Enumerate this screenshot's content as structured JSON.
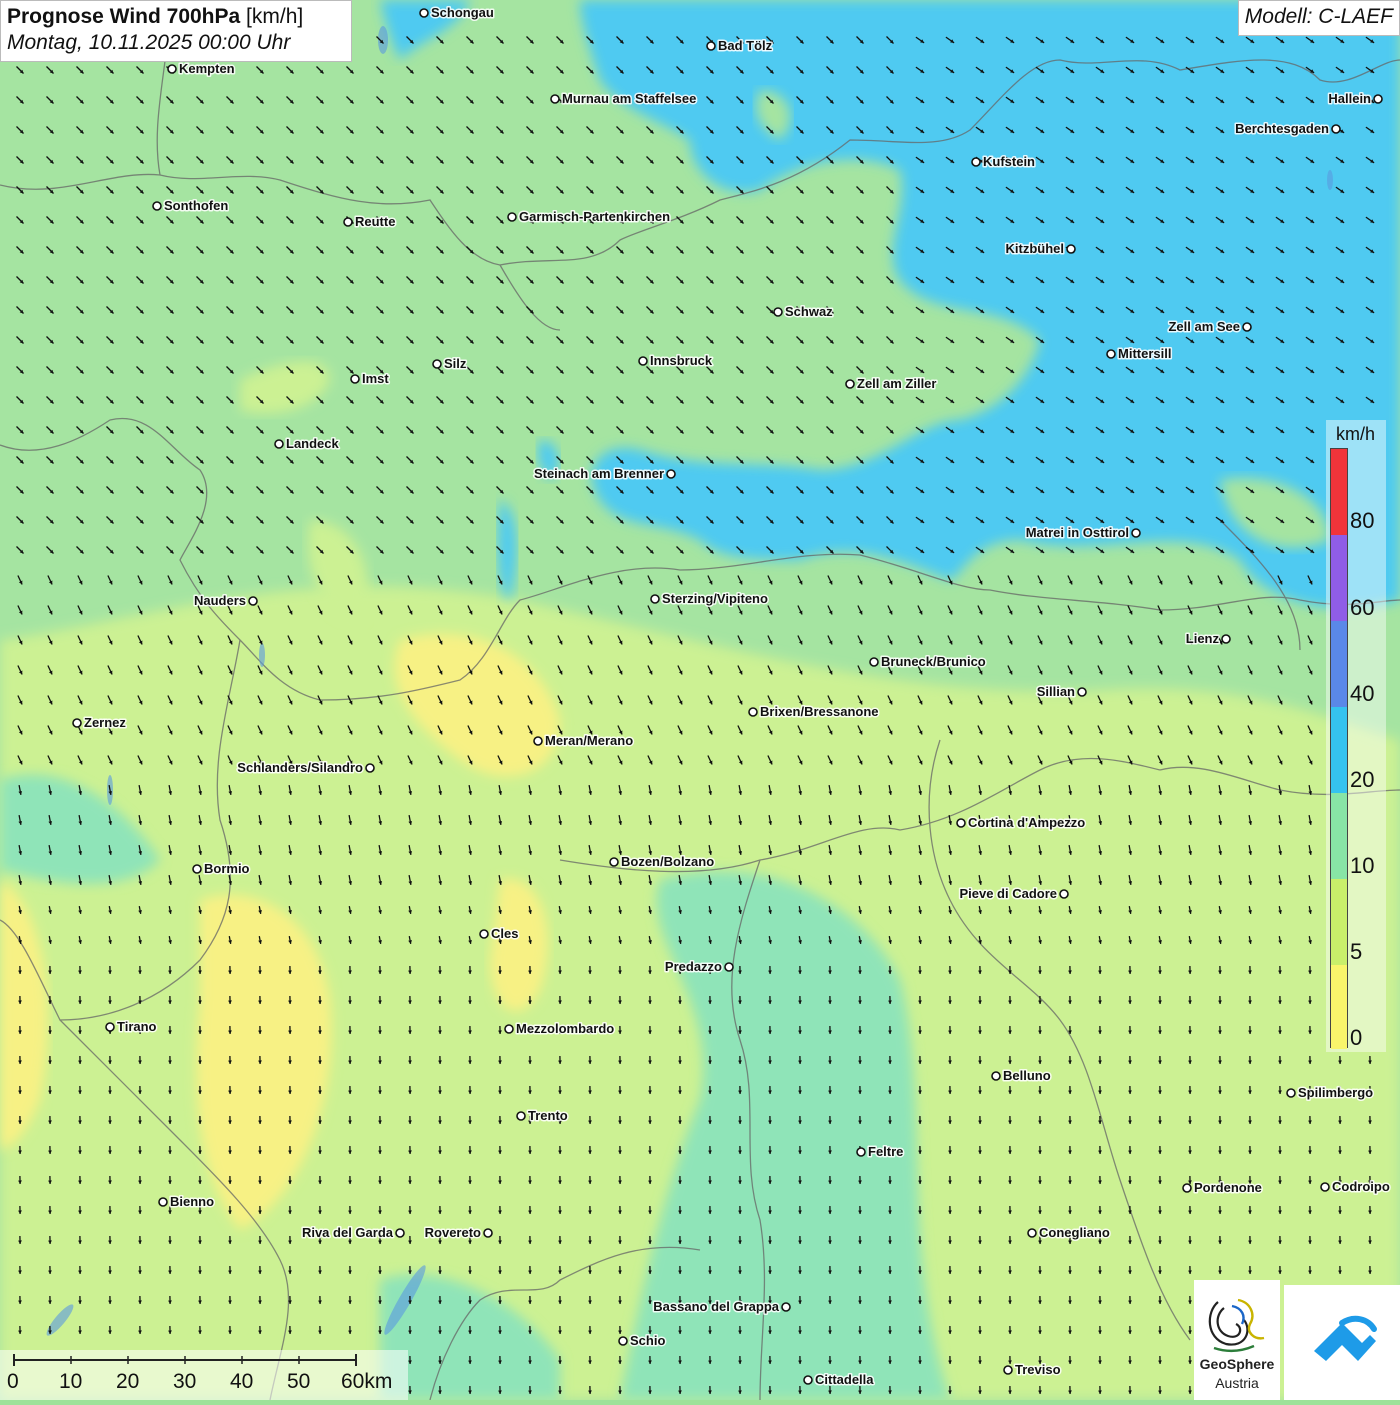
{
  "title": {
    "main_bold": "Prognose Wind 700hPa",
    "unit": "[km/h]",
    "datetime": "Montag, 10.11.2025 00:00 Uhr"
  },
  "model": "Modell: C-LAEF",
  "legend": {
    "unit": "km/h",
    "ticks": [
      "80",
      "60",
      "40",
      "20",
      "10",
      "5",
      "0"
    ],
    "colors": [
      "#f0343a",
      "#8f5de6",
      "#5a88e8",
      "#35c3ef",
      "#88e5a6",
      "#c9ef6a",
      "#f9f56b"
    ]
  },
  "scale_bar": {
    "labels": [
      "0",
      "10",
      "20",
      "30",
      "40",
      "50",
      "60km"
    ]
  },
  "logos": {
    "geosphere_line1": "GeoSphere",
    "geosphere_line2": "Austria"
  },
  "colors": {
    "calm_yellow": "#f7f07a",
    "light_green": "#c8f08a",
    "green": "#9ee29a",
    "teal": "#86e2b2",
    "blue": "#3fc6f0",
    "arrow": "#111111"
  },
  "cities": [
    {
      "name": "Schongau",
      "id": "schongau"
    },
    {
      "name": "Bad Tölz",
      "id": "bad-toelz"
    },
    {
      "name": "Kempten",
      "id": "kempten"
    },
    {
      "name": "Murnau am Staffelsee",
      "id": "murnau"
    },
    {
      "name": "Hallein",
      "id": "hallein"
    },
    {
      "name": "Berchtesgaden",
      "id": "berchtesgaden"
    },
    {
      "name": "Kufstein",
      "id": "kufstein"
    },
    {
      "name": "Sonthofen",
      "id": "sonthofen"
    },
    {
      "name": "Reutte",
      "id": "reutte"
    },
    {
      "name": "Garmisch-Partenkirchen",
      "id": "garmisch"
    },
    {
      "name": "Kitzbühel",
      "id": "kitzbuehel"
    },
    {
      "name": "Schwaz",
      "id": "schwaz"
    },
    {
      "name": "Zell am See",
      "id": "zell-am-see"
    },
    {
      "name": "Mittersill",
      "id": "mittersill"
    },
    {
      "name": "Innsbruck",
      "id": "innsbruck"
    },
    {
      "name": "Silz",
      "id": "silz"
    },
    {
      "name": "Imst",
      "id": "imst"
    },
    {
      "name": "Zell am Ziller",
      "id": "zell-am-ziller"
    },
    {
      "name": "Landeck",
      "id": "landeck"
    },
    {
      "name": "Steinach am Brenner",
      "id": "steinach"
    },
    {
      "name": "Matrei in Osttirol",
      "id": "matrei"
    },
    {
      "name": "Nauders",
      "id": "nauders"
    },
    {
      "name": "Sterzing/Vipiteno",
      "id": "sterzing"
    },
    {
      "name": "Lienz",
      "id": "lienz"
    },
    {
      "name": "Bruneck/Brunico",
      "id": "bruneck"
    },
    {
      "name": "Sillian",
      "id": "sillian"
    },
    {
      "name": "Zernez",
      "id": "zernez"
    },
    {
      "name": "Brixen/Bressanone",
      "id": "brixen"
    },
    {
      "name": "Meran/Merano",
      "id": "meran"
    },
    {
      "name": "Schlanders/Silandro",
      "id": "schlanders"
    },
    {
      "name": "Cortina d'Ampezzo",
      "id": "cortina"
    },
    {
      "name": "Bozen/Bolzano",
      "id": "bozen"
    },
    {
      "name": "Bormio",
      "id": "bormio"
    },
    {
      "name": "Pieve di Cadore",
      "id": "pieve"
    },
    {
      "name": "Cles",
      "id": "cles"
    },
    {
      "name": "Predazzo",
      "id": "predazzo"
    },
    {
      "name": "Tirano",
      "id": "tirano"
    },
    {
      "name": "Mezzolombardo",
      "id": "mezzolombardo"
    },
    {
      "name": "Belluno",
      "id": "belluno"
    },
    {
      "name": "Spilimbergo",
      "id": "spilimbergo"
    },
    {
      "name": "Trento",
      "id": "trento"
    },
    {
      "name": "Feltre",
      "id": "feltre"
    },
    {
      "name": "Pordenone",
      "id": "pordenone"
    },
    {
      "name": "Codroipo",
      "id": "codroipo"
    },
    {
      "name": "Bienno",
      "id": "bienno"
    },
    {
      "name": "Riva del Garda",
      "id": "riva"
    },
    {
      "name": "Rovereto",
      "id": "rovereto"
    },
    {
      "name": "Conegliano",
      "id": "conegliano"
    },
    {
      "name": "Bassano del Grappa",
      "id": "bassano"
    },
    {
      "name": "Schio",
      "id": "schio"
    },
    {
      "name": "Treviso",
      "id": "treviso"
    },
    {
      "name": "Cittadella",
      "id": "cittadella"
    }
  ]
}
